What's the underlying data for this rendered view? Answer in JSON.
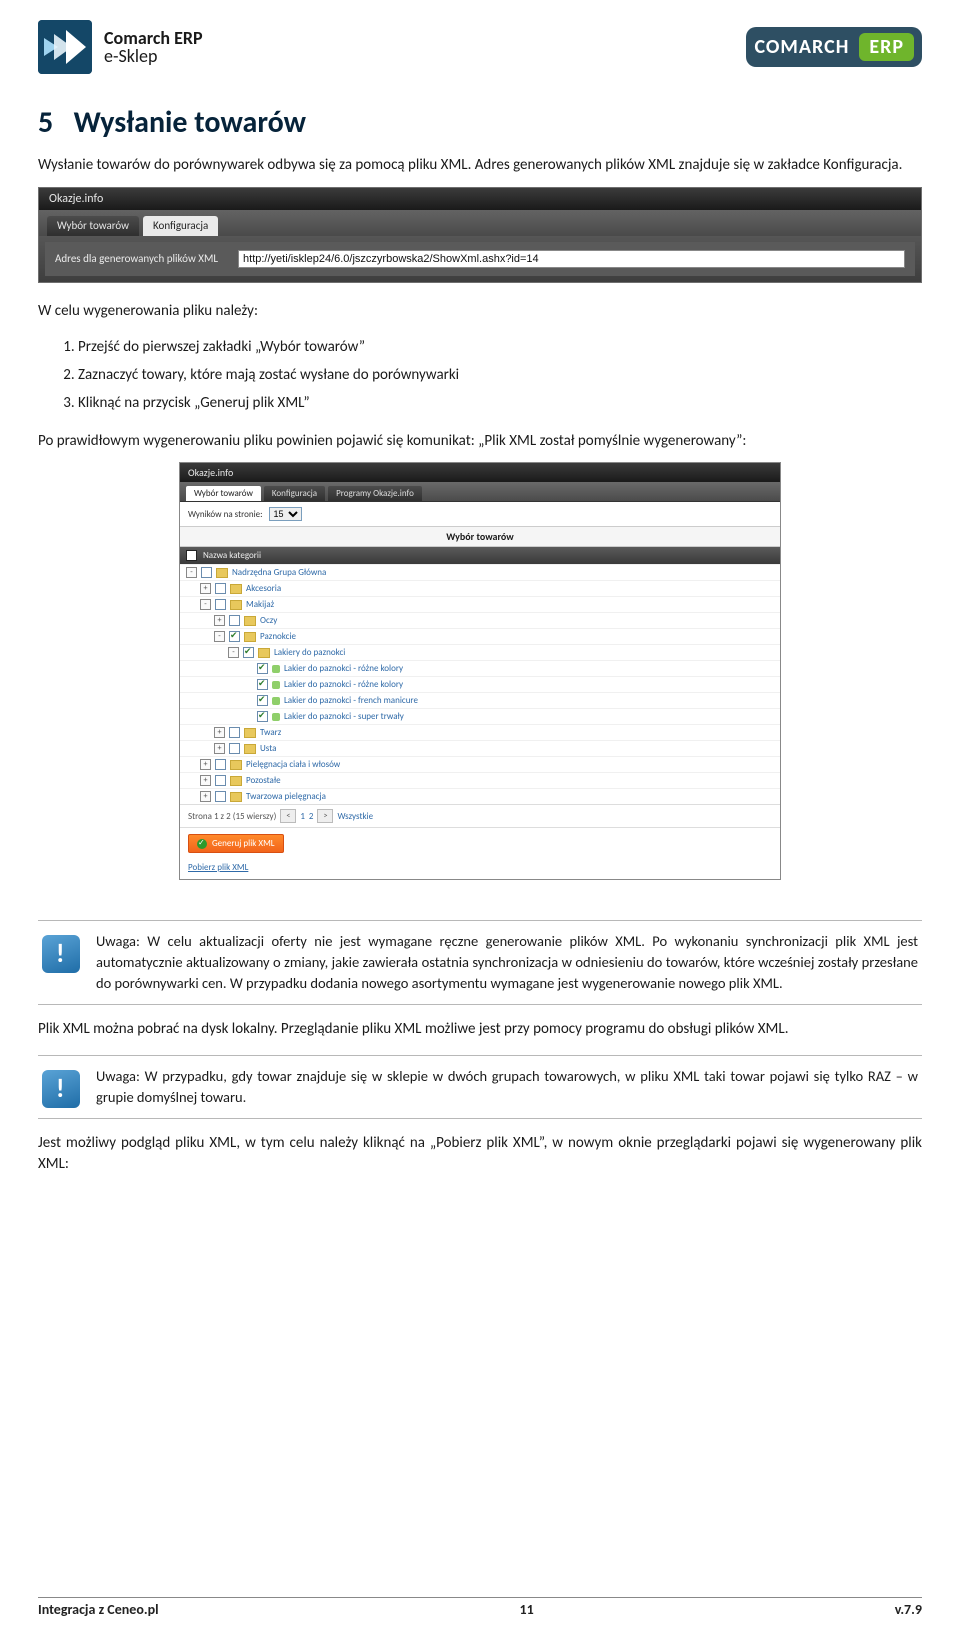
{
  "header": {
    "leftLogoLine1": "Comarch ERP",
    "leftLogoLine2": "e-Sklep",
    "rightBrand": "COMARCH",
    "rightPill": "ERP"
  },
  "section": {
    "number": "5",
    "title": "Wysłanie towarów",
    "intro": "Wysłanie towarów do porównywarek odbywa się za pomocą pliku XML. Adres generowanych plików XML znajduje się w zakładce Konfiguracja."
  },
  "shot1": {
    "windowTitle": "Okazje.info",
    "tabInactive": "Wybór towarów",
    "tabActive": "Konfiguracja",
    "fieldLabel": "Adres dla generowanych plików XML",
    "fieldValue": "http://yeti/isklep24/6.0/jszczyrbowska2/ShowXml.ashx?id=14"
  },
  "stepsIntro": "W celu wygenerowania pliku należy:",
  "steps": [
    "Przejść do pierwszej zakładki „Wybór towarów”",
    "Zaznaczyć towary, które mają zostać wysłane do porównywarki",
    "Kliknąć na przycisk „Generuj plik XML”"
  ],
  "afterSteps": "Po prawidłowym wygenerowaniu pliku powinien pojawić się komunikat: „Plik XML został pomyślnie wygenerowany”:",
  "shot2": {
    "windowTitle": "Okazje.info",
    "tabs": [
      "Wybór towarów",
      "Konfiguracja",
      "Programy Okazje.info"
    ],
    "activeTab": 0,
    "perPageLabel": "Wyników na stronie:",
    "perPageValue": "15",
    "gridTitle": "Wybór towarów",
    "columnHeader": "Nazwa kategorii",
    "tree": [
      {
        "indent": 0,
        "exp": "-",
        "checked": false,
        "type": "folder",
        "label": "Nadrzędna Grupa Główna"
      },
      {
        "indent": 1,
        "exp": "+",
        "checked": false,
        "type": "folder",
        "label": "Akcesoria"
      },
      {
        "indent": 1,
        "exp": "-",
        "checked": false,
        "type": "folder",
        "label": "Makijaż"
      },
      {
        "indent": 2,
        "exp": "+",
        "checked": false,
        "type": "folder",
        "label": "Oczy"
      },
      {
        "indent": 2,
        "exp": "-",
        "checked": true,
        "type": "folder",
        "label": "Paznokcie"
      },
      {
        "indent": 3,
        "exp": "-",
        "checked": true,
        "type": "folder",
        "label": "Lakiery do paznokci"
      },
      {
        "indent": 4,
        "exp": "",
        "checked": true,
        "type": "leaf",
        "label": "Lakier do paznokci - różne kolory"
      },
      {
        "indent": 4,
        "exp": "",
        "checked": true,
        "type": "leaf",
        "label": "Lakier do paznokci - różne kolory"
      },
      {
        "indent": 4,
        "exp": "",
        "checked": true,
        "type": "leaf",
        "label": "Lakier do paznokci - french manicure"
      },
      {
        "indent": 4,
        "exp": "",
        "checked": true,
        "type": "leaf",
        "label": "Lakier do paznokci - super trwały"
      },
      {
        "indent": 2,
        "exp": "+",
        "checked": false,
        "type": "folder",
        "label": "Twarz"
      },
      {
        "indent": 2,
        "exp": "+",
        "checked": false,
        "type": "folder",
        "label": "Usta"
      },
      {
        "indent": 1,
        "exp": "+",
        "checked": false,
        "type": "folder",
        "label": "Pielęgnacja ciała i włosów"
      },
      {
        "indent": 1,
        "exp": "+",
        "checked": false,
        "type": "folder",
        "label": "Pozostałe"
      },
      {
        "indent": 1,
        "exp": "+",
        "checked": false,
        "type": "folder",
        "label": "Twarzowa pielęgnacja"
      }
    ],
    "paginator": "Strona 1 z 2 (15 wierszy)",
    "pagPrev": "<",
    "pag1": "1",
    "pag2": "2",
    "pagNext": ">",
    "pagAll": "Wszystkie",
    "generateBtn": "Generuj plik XML",
    "downloadLink": "Pobierz plik XML"
  },
  "note1": "Uwaga: W celu aktualizacji oferty nie jest wymagane ręczne generowanie plików XML. Po wykonaniu synchronizacji plik XML jest automatycznie aktualizowany o zmiany, jakie zawierała ostatnia synchronizacja w odniesieniu do towarów, które wcześniej zostały przesłane do porównywarki cen. W przypadku dodania nowego asortymentu wymagane jest wygenerowanie nowego plik XML.",
  "mid": "Plik XML można pobrać na dysk lokalny. Przeglądanie pliku XML możliwe jest przy pomocy programu do obsługi plików XML.",
  "note2": "Uwaga: W przypadku, gdy towar znajduje się w sklepie w dwóch grupach towarowych, w pliku XML taki towar pojawi się tylko RAZ – w grupie domyślnej towaru.",
  "tail": "Jest możliwy podgląd pliku XML, w tym celu należy kliknąć na „Pobierz plik XML”, w nowym oknie przeglądarki pojawi się wygenerowany plik XML:",
  "footer": {
    "left": "Integracja z Ceneo.pl",
    "center": "11",
    "right": "v.7.9"
  }
}
